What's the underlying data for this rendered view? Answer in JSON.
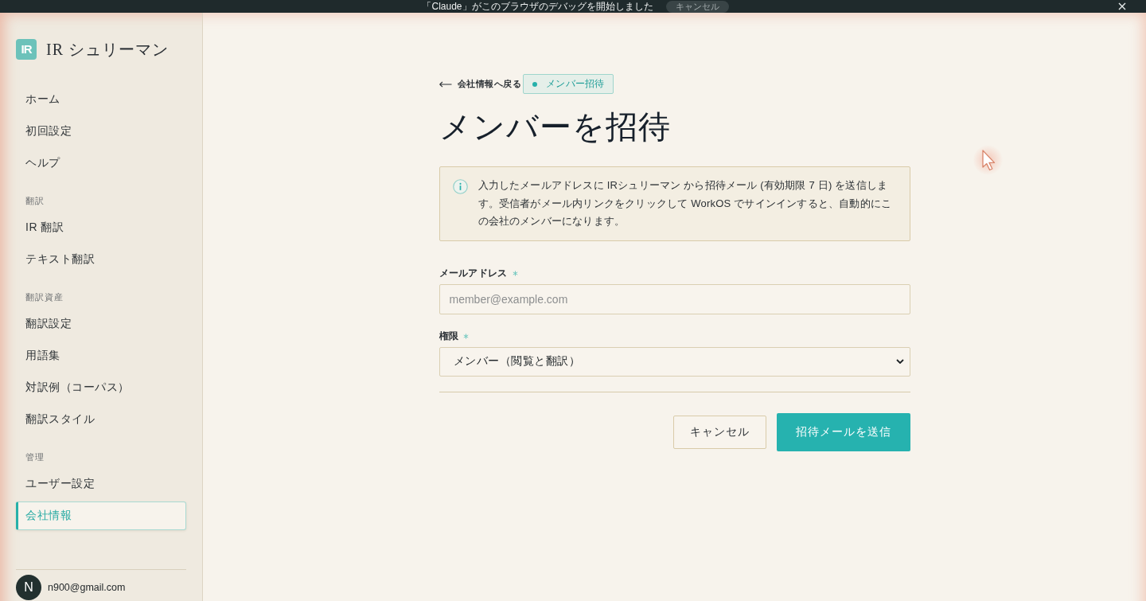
{
  "debug_banner": {
    "message": "「Claude」がこのブラウザのデバッグを開始しました",
    "cancel_button": "キャンセル"
  },
  "sidebar": {
    "logo": {
      "mark": "IR",
      "name": "IR シュリーマン"
    },
    "groups": [
      {
        "items": [
          {
            "label": "ホーム",
            "selected": false
          },
          {
            "label": "初回設定",
            "selected": false
          },
          {
            "label": "ヘルプ",
            "selected": false
          }
        ]
      },
      {
        "heading": "翻訳",
        "items": [
          {
            "label": "IR 翻訳",
            "selected": false
          },
          {
            "label": "テキスト翻訳",
            "selected": false
          }
        ]
      },
      {
        "heading": "翻訳資産",
        "items": [
          {
            "label": "翻訳設定",
            "selected": false
          },
          {
            "label": "用語集",
            "selected": false
          },
          {
            "label": "対訳例（コーパス）",
            "selected": false
          },
          {
            "label": "翻訳スタイル",
            "selected": false
          }
        ]
      },
      {
        "heading": "管理",
        "items": [
          {
            "label": "ユーザー設定",
            "selected": false
          },
          {
            "label": "会社情報",
            "selected": true
          }
        ]
      }
    ],
    "account": {
      "initial": "N",
      "email": "n900@gmail.com"
    }
  },
  "main": {
    "breadcrumb": {
      "back_link": "会社情報へ戻る",
      "current": "メンバー招待"
    },
    "title": "メンバーを招待",
    "notice": "入力したメールアドレスに IRシュリーマン から招待メール (有効期限 7 日) を送信します。受信者がメール内リンクをクリックして WorkOS でサインインすると、自動的にこの会社のメンバーになります。",
    "form": {
      "fields": [
        {
          "kind": "text",
          "label": "メールアドレス",
          "required": true,
          "placeholder": "member@example.com"
        },
        {
          "kind": "select",
          "label": "権限",
          "required": true,
          "value": "メンバー（閲覧と翻訳）"
        }
      ],
      "buttons": [
        {
          "kind": "secondary",
          "label": "キャンセル"
        },
        {
          "kind": "primary",
          "label": "招待メールを送信"
        }
      ]
    }
  }
}
